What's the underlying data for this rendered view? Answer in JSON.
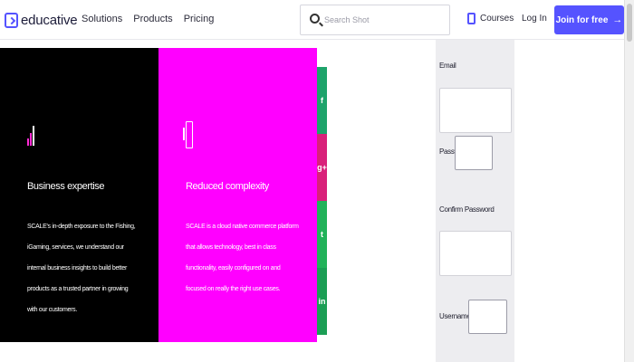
{
  "header": {
    "logo": "educative",
    "nav": [
      "Solutions",
      "Products",
      "Pricing"
    ],
    "search_placeholder": "Search Shot",
    "courses": "Courses",
    "login": "Log In",
    "join": "Join for free",
    "join_arrow": "→"
  },
  "features": [
    {
      "icon": "bar-chart-icon",
      "title": "Business expertise",
      "body": "SCALE's in-depth exposure to the Fishing, iGaming, services, we understand our internal business insights to build better products as a trusted partner in growing with our customers."
    },
    {
      "icon": "mobile-phone-icon",
      "title": "Reduced complexity",
      "body": "SCALE is a cloud native commerce platform that allows technology, best in class functionality, easily configured on and focused on really the right use cases."
    }
  ],
  "share": [
    {
      "icon": "facebook-icon",
      "glyph": "f",
      "color": "#1ea36b"
    },
    {
      "icon": "google-plus-icon",
      "glyph": "g+",
      "color": "#d9217a"
    },
    {
      "icon": "twitter-icon",
      "glyph": "t",
      "color": "#22b25a"
    },
    {
      "icon": "linkedin-icon",
      "glyph": "in",
      "color": "#1c9e55"
    }
  ],
  "form": {
    "email_label": "Email",
    "password_label": "Password",
    "confirm_password_label": "Confirm Password",
    "username_label": "Username (optional)"
  }
}
